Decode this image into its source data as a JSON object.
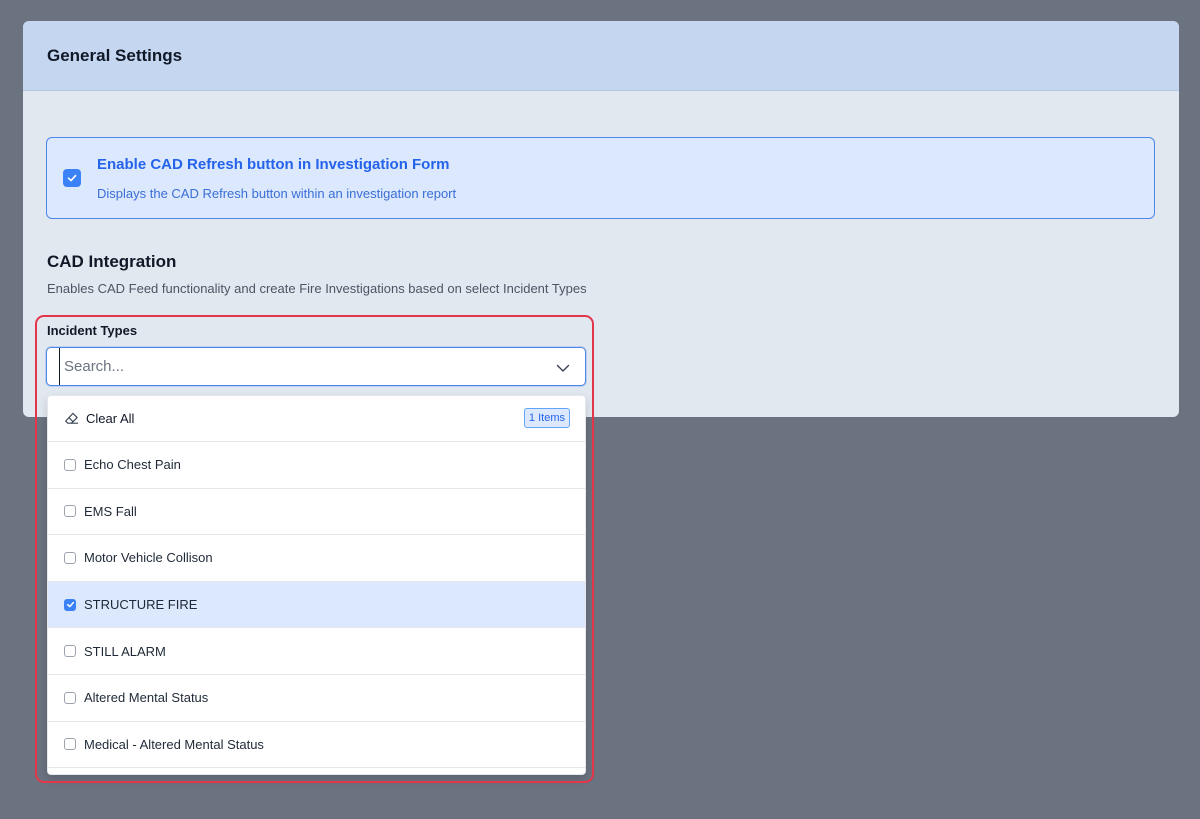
{
  "panel": {
    "title": "General Settings"
  },
  "cad_refresh_option": {
    "checked": true,
    "title": "Enable CAD Refresh button in Investigation Form",
    "description": "Displays the CAD Refresh button within an investigation report"
  },
  "cad_integration": {
    "title": "CAD Integration",
    "description": "Enables CAD Feed functionality and create Fire Investigations based on select Incident Types"
  },
  "incident_types": {
    "label": "Incident Types",
    "search_placeholder": "Search...",
    "search_value": "",
    "clear_all_label": "Clear All",
    "selected_count_badge": "1 Items",
    "options": [
      {
        "label": "Echo Chest Pain",
        "checked": false
      },
      {
        "label": "EMS Fall",
        "checked": false
      },
      {
        "label": "Motor Vehicle Collison",
        "checked": false
      },
      {
        "label": "STRUCTURE FIRE",
        "checked": true
      },
      {
        "label": "STILL ALARM",
        "checked": false
      },
      {
        "label": "Altered Mental Status",
        "checked": false
      },
      {
        "label": "Medical - Altered Mental Status",
        "checked": false
      }
    ]
  },
  "colors": {
    "background": "#6b7280",
    "panel": "#e2e8f0",
    "panel_header": "#c5d7f0",
    "accent": "#3b82f6",
    "accent_text": "#2563eb",
    "highlight_outline": "#e3364b",
    "selected_row": "#dbe8fd"
  },
  "icons": {
    "checkbox_checked": "check-icon",
    "dropdown": "chevron-down-icon",
    "clear": "eraser-icon"
  }
}
